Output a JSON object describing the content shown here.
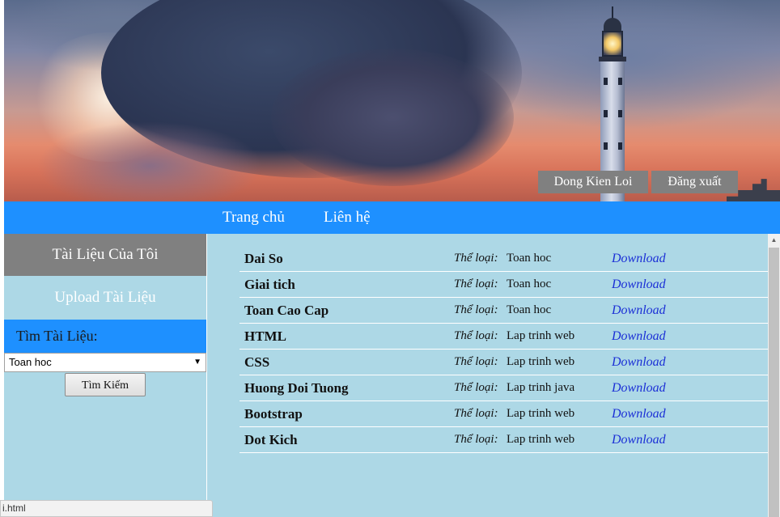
{
  "header": {
    "user_button": "Dong Kien Loi",
    "logout_button": "Đăng xuất"
  },
  "nav": {
    "items": [
      {
        "label": "Trang chủ"
      },
      {
        "label": "Liên hệ"
      }
    ]
  },
  "sidebar": {
    "my_docs": "Tài Liệu Của Tôi",
    "upload": "Upload Tài Liệu",
    "search_heading": "Tìm Tài Liệu:",
    "category_select": "Toan hoc",
    "search_button": "Tìm Kiếm"
  },
  "documents": {
    "category_label": "Thể loại:",
    "download_label": "Download",
    "rows": [
      {
        "name": "Dai So",
        "category": "Toan hoc"
      },
      {
        "name": "Giai tich",
        "category": "Toan hoc"
      },
      {
        "name": "Toan Cao Cap",
        "category": "Toan hoc"
      },
      {
        "name": "HTML",
        "category": "Lap trinh web"
      },
      {
        "name": "CSS",
        "category": "Lap trinh web"
      },
      {
        "name": "Huong Doi Tuong",
        "category": "Lap trinh java"
      },
      {
        "name": "Bootstrap",
        "category": "Lap trinh web"
      },
      {
        "name": "Dot Kich",
        "category": "Lap trinh web"
      }
    ]
  },
  "status_bar": {
    "url": "i.html"
  },
  "colors": {
    "nav_blue": "#1e90ff",
    "panel_lightblue": "#add8e6",
    "gray": "#808080",
    "link_blue": "#1b2fd6"
  }
}
